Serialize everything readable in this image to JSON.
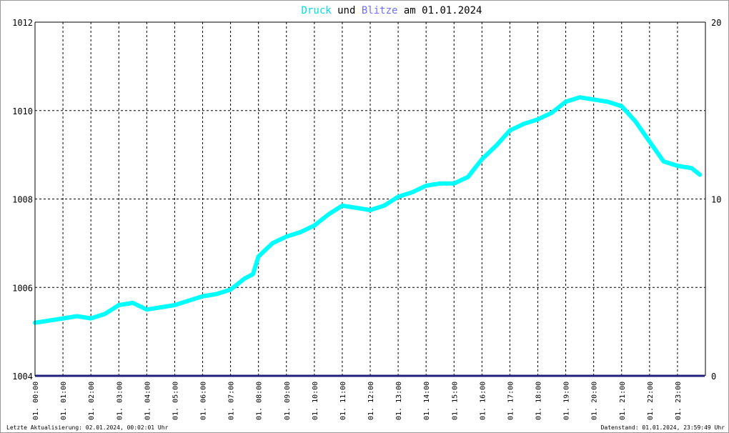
{
  "chart_data": {
    "type": "line",
    "title": {
      "part1": "Druck",
      "part2": " und ",
      "part3": "Blitze",
      "part4": " am 01.01.2024"
    },
    "colors": {
      "pressure": "#00ffff",
      "lightning": "#20207a",
      "title_pressure": "#00e0e0",
      "title_lightning": "#7070ff",
      "grid": "#000000",
      "text": "#000000"
    },
    "y_left": {
      "ticks": [
        1004,
        1006,
        1008,
        1010,
        1012
      ],
      "labels": [
        "1004",
        "1006",
        "1008",
        "1010",
        "1012"
      ],
      "ylim": [
        1004,
        1012
      ]
    },
    "y_right": {
      "ticks": [
        0,
        10,
        20
      ],
      "labels": [
        "0",
        "10",
        "20"
      ],
      "ylim": [
        0,
        20
      ]
    },
    "x_hours": [
      0,
      1,
      2,
      3,
      4,
      5,
      6,
      7,
      8,
      9,
      10,
      11,
      12,
      13,
      14,
      15,
      16,
      17,
      18,
      19,
      20,
      21,
      22,
      23
    ],
    "x_labels": [
      "01. 00:00",
      "01. 01:00",
      "01. 02:00",
      "01. 03:00",
      "01. 04:00",
      "01. 05:00",
      "01. 06:00",
      "01. 07:00",
      "01. 08:00",
      "01. 09:00",
      "01. 10:00",
      "01. 11:00",
      "01. 12:00",
      "01. 13:00",
      "01. 14:00",
      "01. 15:00",
      "01. 16:00",
      "01. 17:00",
      "01. 18:00",
      "01. 19:00",
      "01. 20:00",
      "01. 21:00",
      "01. 22:00",
      "01. 23:00"
    ],
    "xlim_hours": [
      0,
      24
    ],
    "grid": true,
    "series": [
      {
        "name": "Druck",
        "axis": "left",
        "hours": [
          0,
          0.5,
          1,
          1.5,
          2,
          2.5,
          3,
          3.5,
          4,
          4.5,
          5,
          5.5,
          6,
          6.5,
          7,
          7.5,
          7.8,
          8,
          8.5,
          9,
          9.5,
          10,
          10.5,
          11,
          11.5,
          12,
          12.5,
          13,
          13.5,
          14,
          14.5,
          15,
          15.5,
          16,
          16.5,
          17,
          17.5,
          18,
          18.5,
          19,
          19.5,
          20,
          20.5,
          21,
          21.5,
          22,
          22.5,
          23,
          23.5,
          23.8
        ],
        "values": [
          1005.2,
          1005.25,
          1005.3,
          1005.35,
          1005.3,
          1005.4,
          1005.6,
          1005.65,
          1005.5,
          1005.55,
          1005.6,
          1005.7,
          1005.8,
          1005.85,
          1005.95,
          1006.2,
          1006.3,
          1006.7,
          1007.0,
          1007.15,
          1007.25,
          1007.4,
          1007.65,
          1007.85,
          1007.8,
          1007.75,
          1007.85,
          1008.05,
          1008.15,
          1008.3,
          1008.35,
          1008.35,
          1008.5,
          1008.9,
          1009.2,
          1009.55,
          1009.7,
          1009.8,
          1009.95,
          1010.2,
          1010.3,
          1010.25,
          1010.2,
          1010.1,
          1009.75,
          1009.3,
          1008.85,
          1008.75,
          1008.7,
          1008.55
        ]
      },
      {
        "name": "Blitze",
        "axis": "right",
        "hours": [
          0,
          23.98
        ],
        "values": [
          0,
          0
        ]
      }
    ]
  },
  "footer": {
    "left": "Letzte Aktualisierung: 02.01.2024, 00:02:01 Uhr",
    "right": "Datenstand: 01.01.2024, 23:59:49 Uhr"
  }
}
